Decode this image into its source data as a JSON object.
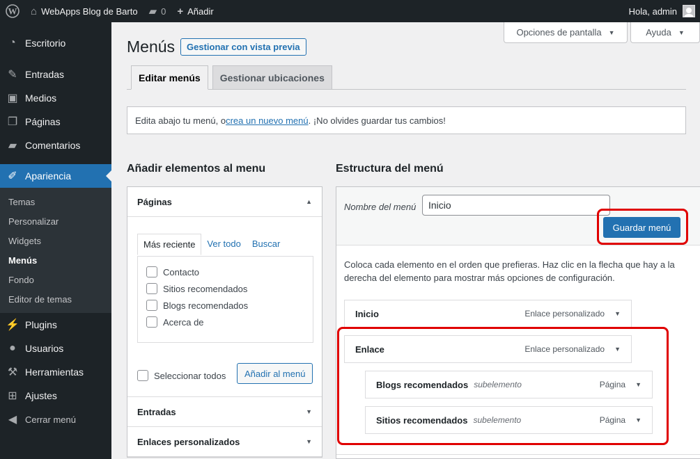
{
  "adminbar": {
    "site_name": "WebApps Blog de Barto",
    "comments_count": "0",
    "new_label": "Añadir",
    "greeting": "Hola, admin"
  },
  "sidebar": {
    "items": [
      {
        "label": "Escritorio",
        "icon": "dashboard-icon"
      },
      {
        "label": "Entradas",
        "icon": "pin-icon"
      },
      {
        "label": "Medios",
        "icon": "media-icon"
      },
      {
        "label": "Páginas",
        "icon": "pages-icon"
      },
      {
        "label": "Comentarios",
        "icon": "comment-icon"
      },
      {
        "label": "Apariencia",
        "icon": "brush-icon"
      }
    ],
    "submenu": [
      "Temas",
      "Personalizar",
      "Widgets",
      "Menús",
      "Fondo",
      "Editor de temas"
    ],
    "items_after": [
      {
        "label": "Plugins",
        "icon": "plugin-icon"
      },
      {
        "label": "Usuarios",
        "icon": "users-icon"
      },
      {
        "label": "Herramientas",
        "icon": "tools-icon"
      },
      {
        "label": "Ajustes",
        "icon": "settings-icon"
      },
      {
        "label": "Cerrar menú",
        "icon": "collapse-icon"
      }
    ]
  },
  "screen_options": {
    "options_label": "Opciones de pantalla",
    "help_label": "Ayuda"
  },
  "page": {
    "title": "Menús",
    "preview_button": "Gestionar con vista previa",
    "tabs": [
      "Editar menús",
      "Gestionar ubicaciones"
    ]
  },
  "notice": {
    "before": "Edita abajo tu menú, o ",
    "link": "crea un nuevo menú",
    "after": ". ¡No olvides guardar tus cambios!"
  },
  "left_panel": {
    "heading": "Añadir elementos al menu",
    "section_pages": "Páginas",
    "tabs": [
      "Más reciente",
      "Ver todo",
      "Buscar"
    ],
    "pages": [
      "Contacto",
      "Sitios recomendados",
      "Blogs recomendados",
      "Acerca de"
    ],
    "select_all": "Seleccionar todos",
    "add_button": "Añadir al menú",
    "section_posts": "Entradas",
    "section_links": "Enlaces personalizados"
  },
  "right_panel": {
    "heading": "Estructura del menú",
    "name_label": "Nombre del menú",
    "name_value": "Inicio",
    "save_button": "Guardar menú",
    "instructions": "Coloca cada elemento en el orden que prefieras. Haz clic en la flecha que hay a la derecha del elemento para mostrar más opciones de configuración.",
    "items": [
      {
        "title": "Inicio",
        "sub": "",
        "type": "Enlace personalizado"
      },
      {
        "title": "Enlace",
        "sub": "",
        "type": "Enlace personalizado"
      },
      {
        "title": "Blogs recomendados",
        "sub": "subelemento",
        "type": "Página"
      },
      {
        "title": "Sitios recomendados",
        "sub": "subelemento",
        "type": "Página"
      }
    ]
  },
  "colors": {
    "accent": "#2271b1",
    "highlight": "#e00000",
    "admin_dark": "#1d2327"
  }
}
